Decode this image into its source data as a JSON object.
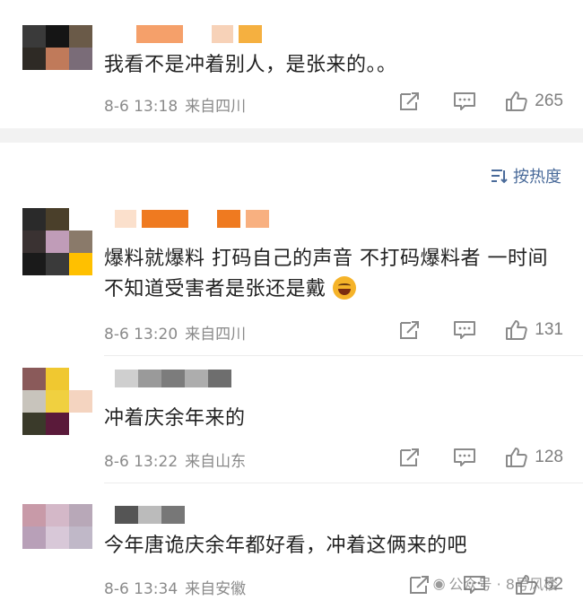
{
  "comments": [
    {
      "text": "我看不是冲着别人，是张来的。。",
      "date": "8-6 13:18",
      "location": "来自四川",
      "likes": "265",
      "avatar_colors": [
        "#3a3a3a",
        "#151515",
        "#6a5a48",
        "#2e2a25",
        "#c07a5a",
        "#7a6c78"
      ],
      "name_colors": [
        "#f5a06a",
        "#f7d2b8",
        "#f8c08a",
        "#f5b040"
      ]
    },
    {
      "text": "爆料就爆料 打码自己的声音 不打码爆料者 一时间不知道受害者是张还是戴",
      "date": "8-6 13:20",
      "location": "来自四川",
      "likes": "131",
      "avatar_colors": [
        "#2a2a2a",
        "#4a3f2a",
        "#ffffff",
        "#3a3232",
        "#c09cb8",
        "#8a7a6a",
        "#1a1a1a",
        "#3a3a3a",
        "#ffc000"
      ],
      "name_colors": [
        "#fbe0cc",
        "#ef7a20",
        "#ef7a20",
        "#f8b080"
      ]
    },
    {
      "text": "冲着庆余年来的",
      "date": "8-6 13:22",
      "location": "来自山东",
      "likes": "128",
      "avatar_colors": [
        "#8a5a5a",
        "#f0c830",
        "#ffffff",
        "#c8c4bc",
        "#f0d040",
        "#f4d4c0",
        "#3a3a2a",
        "#5a1a3a",
        "#ffffff"
      ],
      "name_colors": [
        "#bdbdbd",
        "#9a9a9a",
        "#8a8a8a",
        "#aaaaaa",
        "#777777"
      ]
    },
    {
      "text": "今年唐诡庆余年都好看，冲着这俩来的吧",
      "date": "8-6 13:34",
      "location": "来自安徽",
      "likes": "52",
      "avatar_colors": [
        "#c89aa8",
        "#d4b8c8",
        "#b8a8b8",
        "#b8a0b8",
        "#d8c8d8",
        "#c0b8c8"
      ],
      "name_colors": [
        "#555555",
        "#bbbbbb",
        "#777777"
      ]
    }
  ],
  "sort": {
    "label": "按热度"
  },
  "watermark": {
    "text": "公众号 · 8号风楼"
  }
}
